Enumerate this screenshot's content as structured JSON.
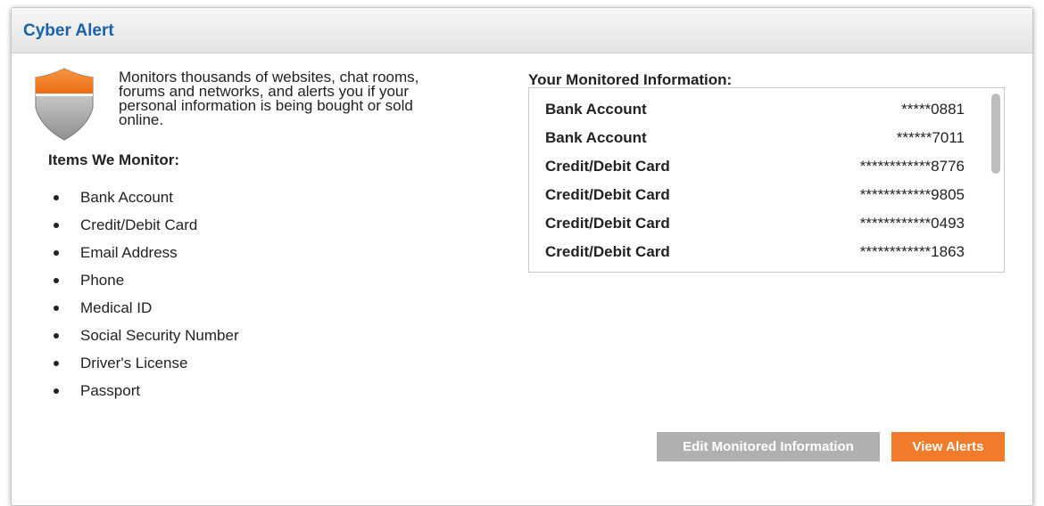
{
  "panel": {
    "title": "Cyber Alert"
  },
  "intro": {
    "icon": "shield-icon",
    "lines": [
      "Monitors thousands of websites, chat rooms,",
      "forums and networks, and alerts you if your",
      "personal information is being bought or sold",
      "online."
    ]
  },
  "items_monitor": {
    "title": "Items We Monitor:",
    "items": [
      "Bank Account",
      "Credit/Debit Card",
      "Email Address",
      "Phone",
      "Medical ID",
      "Social Security Number",
      "Driver's License",
      "Passport"
    ]
  },
  "monitored": {
    "title": "Your Monitored Information:",
    "rows": [
      {
        "label": "Bank Account",
        "value": "*****0881"
      },
      {
        "label": "Bank Account",
        "value": "******7011"
      },
      {
        "label": "Credit/Debit Card",
        "value": "************8776"
      },
      {
        "label": "Credit/Debit Card",
        "value": "************9805"
      },
      {
        "label": "Credit/Debit Card",
        "value": "************0493"
      },
      {
        "label": "Credit/Debit Card",
        "value": "************1863"
      }
    ]
  },
  "buttons": {
    "edit_label": "Edit Monitored Information",
    "view_label": "View Alerts"
  },
  "colors": {
    "title_blue": "#1a62a8",
    "accent_orange": "#f07b2a",
    "disabled_gray": "#b0b0b0"
  }
}
